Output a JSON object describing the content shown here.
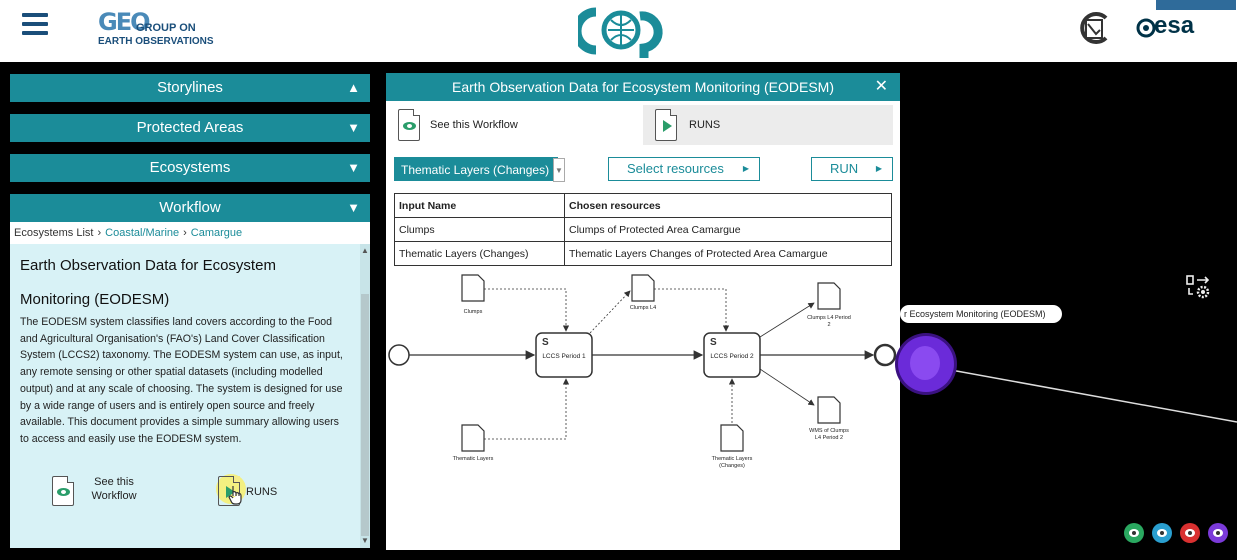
{
  "header": {
    "geo_logo": {
      "mark": "GEO",
      "line1": "GROUP ON",
      "line2": "EARTH OBSERVATIONS"
    },
    "esa_logo": "esa",
    "ecop_logo": "ecop"
  },
  "sidebar": {
    "sections": [
      {
        "label": "Storylines",
        "chevron": "up"
      },
      {
        "label": "Protected Areas",
        "chevron": "down"
      },
      {
        "label": "Ecosystems",
        "chevron": "down"
      },
      {
        "label": "Workflow",
        "chevron": "down"
      }
    ],
    "breadcrumb": [
      "Ecosystems List",
      "Coastal/Marine",
      "Camargue"
    ],
    "doc_title_line1": "Earth Observation Data for Ecosystem",
    "doc_title_line2": "Monitoring (EODESM)",
    "description": "The EODESM system classifies land covers according to the Food and Agricultural Organisation's (FAO's) Land Cover Classification System (LCCS2) taxonomy. The EODESM system can use, as input, any remote sensing or other spatial datasets (including modelled output) and at any scale of choosing. The system is designed for use by a wide range of users and is entirely open source and freely available. This document provides a simple summary allowing users to access and easily use the EODESM system.",
    "see_workflow_line1": "See this",
    "see_workflow_line2": "Workflow",
    "runs_label": "RUNS"
  },
  "modal": {
    "title": "Earth Observation Data for Ecosystem Monitoring (EODESM)",
    "tab_see_workflow": "See this Workflow",
    "tab_runs": "RUNS",
    "select_value": "Thematic Layers (Changes)",
    "select_resources_label": "Select resources",
    "run_label": "RUN",
    "table": {
      "headers": [
        "Input Name",
        "Chosen resources"
      ],
      "rows": [
        [
          "Clumps",
          "Clumps of Protected Area Camargue"
        ],
        [
          "Thematic Layers (Changes)",
          "Thematic Layers Changes of Protected Area Camargue"
        ]
      ]
    },
    "workflow": {
      "docs": {
        "clumps": "Clumps",
        "clumps_l4": "Clumps L4",
        "clumps_l4_p2_a": "Clumps L4 Period",
        "clumps_l4_p2_b": "2",
        "thematic_layers": "Thematic Layers",
        "thematic_changes_a": "Thematic Layers",
        "thematic_changes_b": "(Changes)",
        "wms_a": "WMS of Clumps",
        "wms_b": "L4 Period 2"
      },
      "tasks": {
        "lccs1": "LCCS Period 1",
        "lccs2": "LCCS Period 2"
      }
    }
  },
  "graph": {
    "hover_label": "r Ecosystem Monitoring (EODESM)"
  },
  "colors": {
    "teal": "#1b8c99",
    "node_purple": "#6b2bd9",
    "dots": [
      "#2aa860",
      "#2a9fd0",
      "#d93030",
      "#7b3ad9"
    ]
  }
}
